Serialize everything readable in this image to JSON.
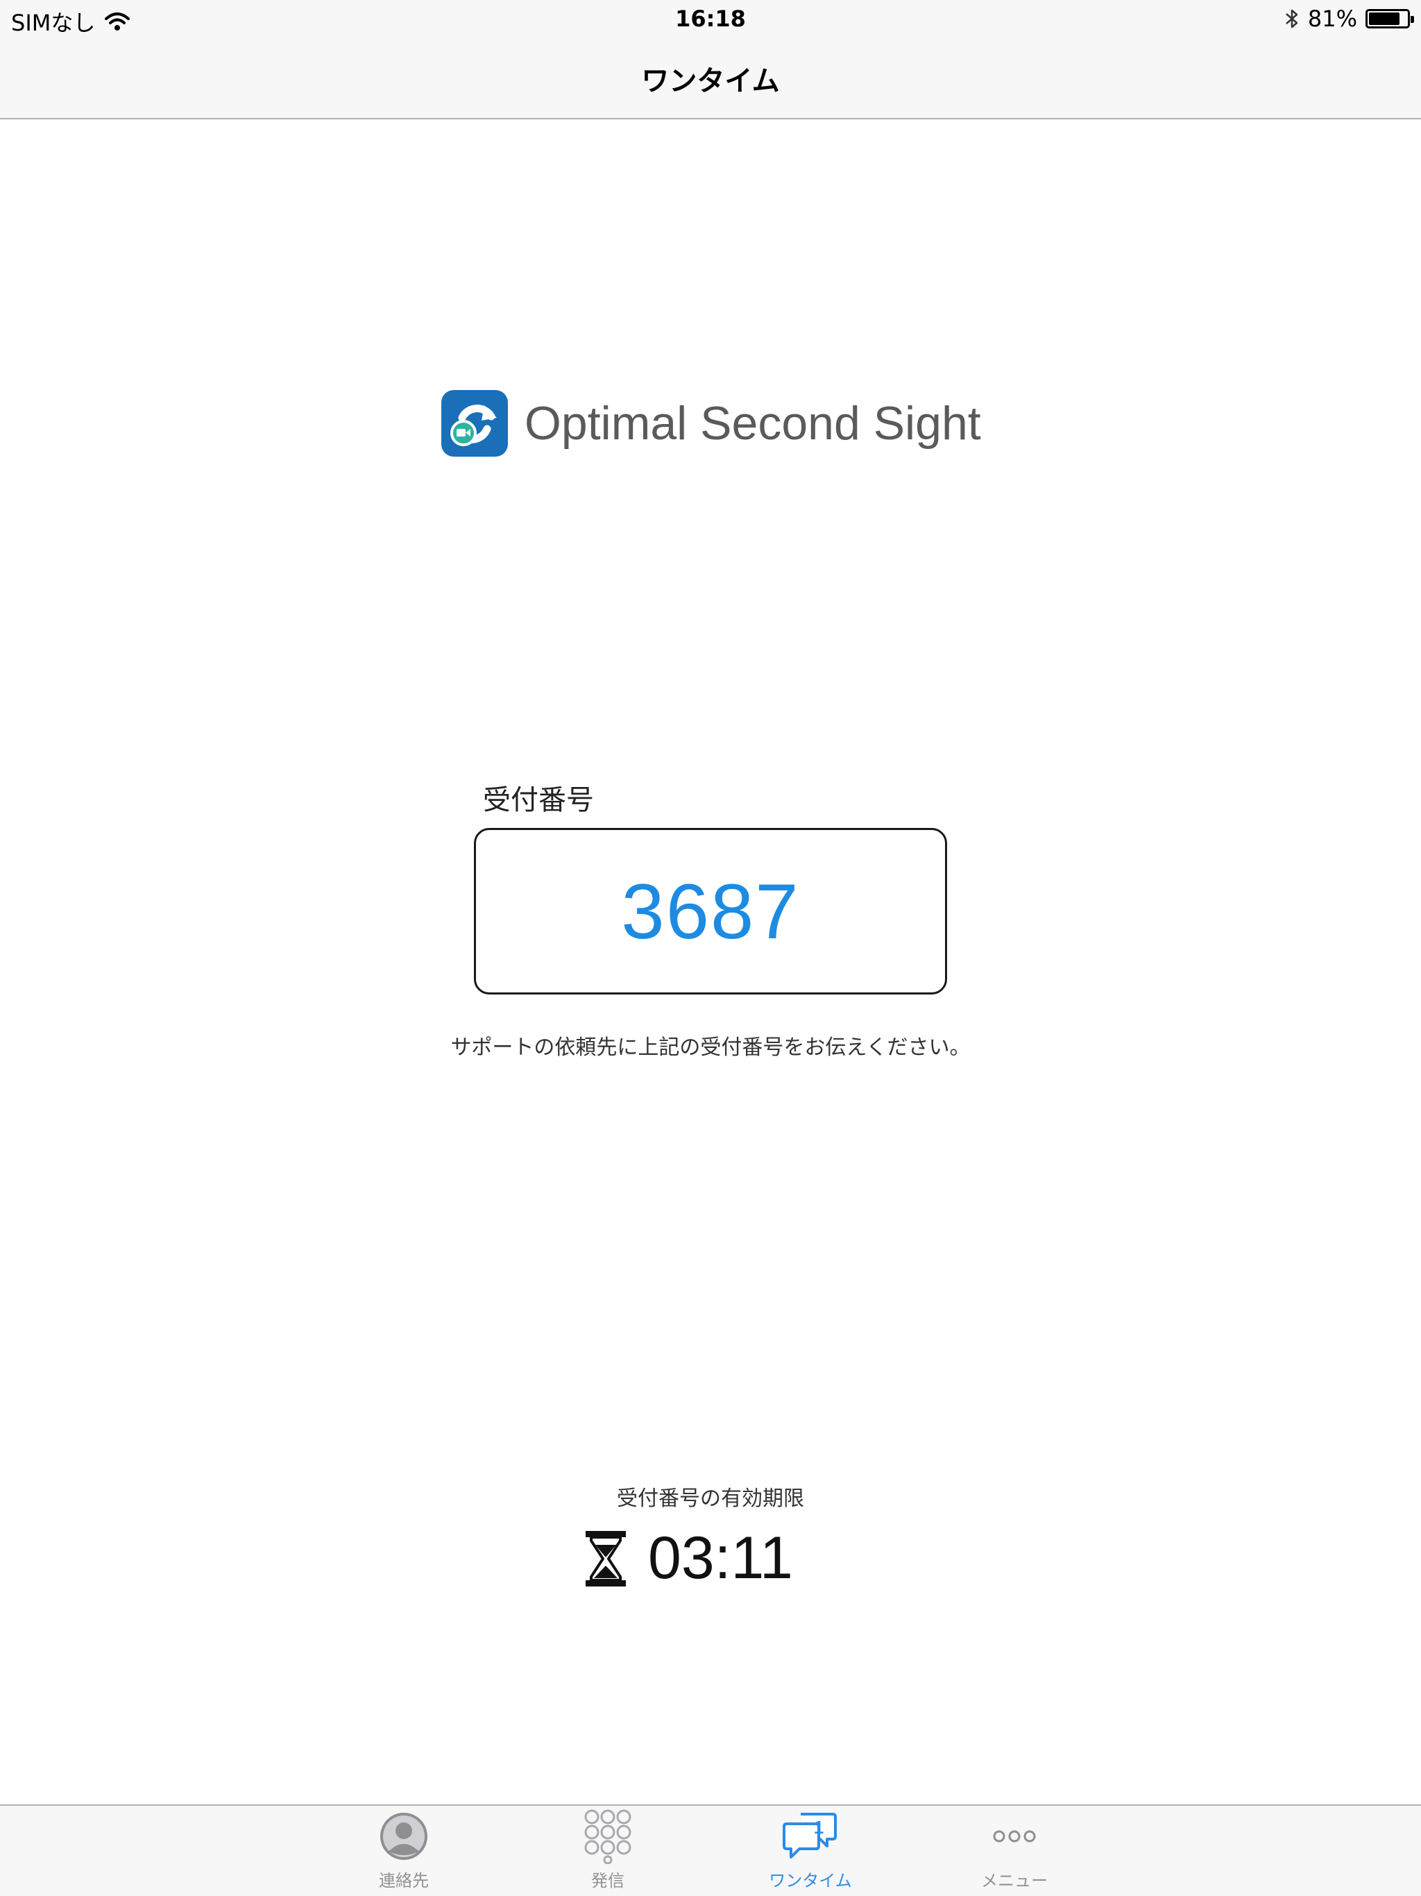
{
  "status_bar": {
    "carrier": "SIMなし",
    "time": "16:18",
    "battery_percent": "81%",
    "battery_level": 0.81
  },
  "nav": {
    "title": "ワンタイム"
  },
  "logo": {
    "name": "Optimal Second Sight"
  },
  "reception": {
    "label": "受付番号",
    "code": "3687",
    "instruction": "サポートの依頼先に上記の受付番号をお伝えください。"
  },
  "expiry": {
    "label": "受付番号の有効期限",
    "timer": "03:11"
  },
  "tabs": [
    {
      "label": "連絡先",
      "icon": "person-icon",
      "active": false
    },
    {
      "label": "発信",
      "icon": "keypad-icon",
      "active": false
    },
    {
      "label": "ワンタイム",
      "icon": "chat-bubble-icon",
      "active": true,
      "badge": "1"
    },
    {
      "label": "メニュー",
      "icon": "more-icon",
      "active": false
    }
  ],
  "colors": {
    "accent": "#2a8ce8",
    "code": "#1e8be0",
    "logo_blue": "#1a6fb8",
    "logo_green": "#2bb5a0"
  }
}
